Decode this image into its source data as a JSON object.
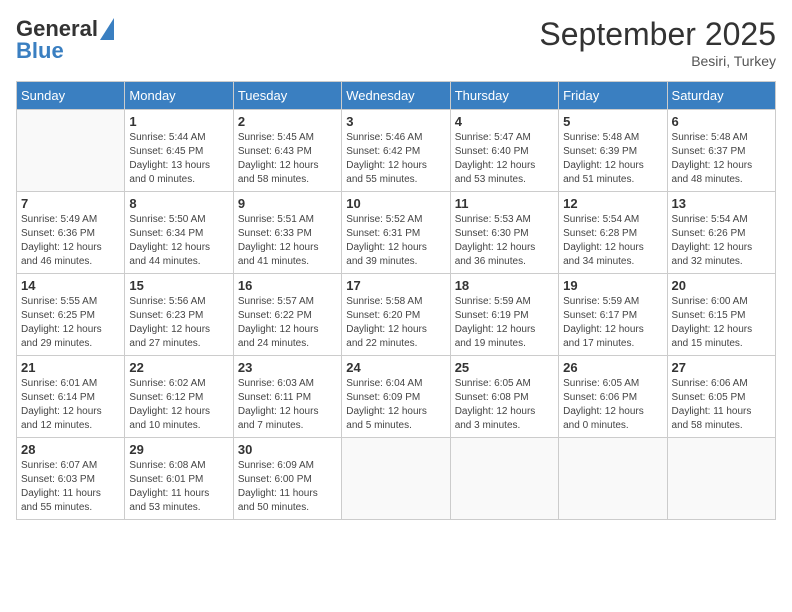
{
  "header": {
    "logo_general": "General",
    "logo_blue": "Blue",
    "month": "September 2025",
    "location": "Besiri, Turkey"
  },
  "days_of_week": [
    "Sunday",
    "Monday",
    "Tuesday",
    "Wednesday",
    "Thursday",
    "Friday",
    "Saturday"
  ],
  "weeks": [
    [
      {
        "day": "",
        "info": ""
      },
      {
        "day": "1",
        "info": "Sunrise: 5:44 AM\nSunset: 6:45 PM\nDaylight: 13 hours\nand 0 minutes."
      },
      {
        "day": "2",
        "info": "Sunrise: 5:45 AM\nSunset: 6:43 PM\nDaylight: 12 hours\nand 58 minutes."
      },
      {
        "day": "3",
        "info": "Sunrise: 5:46 AM\nSunset: 6:42 PM\nDaylight: 12 hours\nand 55 minutes."
      },
      {
        "day": "4",
        "info": "Sunrise: 5:47 AM\nSunset: 6:40 PM\nDaylight: 12 hours\nand 53 minutes."
      },
      {
        "day": "5",
        "info": "Sunrise: 5:48 AM\nSunset: 6:39 PM\nDaylight: 12 hours\nand 51 minutes."
      },
      {
        "day": "6",
        "info": "Sunrise: 5:48 AM\nSunset: 6:37 PM\nDaylight: 12 hours\nand 48 minutes."
      }
    ],
    [
      {
        "day": "7",
        "info": "Sunrise: 5:49 AM\nSunset: 6:36 PM\nDaylight: 12 hours\nand 46 minutes."
      },
      {
        "day": "8",
        "info": "Sunrise: 5:50 AM\nSunset: 6:34 PM\nDaylight: 12 hours\nand 44 minutes."
      },
      {
        "day": "9",
        "info": "Sunrise: 5:51 AM\nSunset: 6:33 PM\nDaylight: 12 hours\nand 41 minutes."
      },
      {
        "day": "10",
        "info": "Sunrise: 5:52 AM\nSunset: 6:31 PM\nDaylight: 12 hours\nand 39 minutes."
      },
      {
        "day": "11",
        "info": "Sunrise: 5:53 AM\nSunset: 6:30 PM\nDaylight: 12 hours\nand 36 minutes."
      },
      {
        "day": "12",
        "info": "Sunrise: 5:54 AM\nSunset: 6:28 PM\nDaylight: 12 hours\nand 34 minutes."
      },
      {
        "day": "13",
        "info": "Sunrise: 5:54 AM\nSunset: 6:26 PM\nDaylight: 12 hours\nand 32 minutes."
      }
    ],
    [
      {
        "day": "14",
        "info": "Sunrise: 5:55 AM\nSunset: 6:25 PM\nDaylight: 12 hours\nand 29 minutes."
      },
      {
        "day": "15",
        "info": "Sunrise: 5:56 AM\nSunset: 6:23 PM\nDaylight: 12 hours\nand 27 minutes."
      },
      {
        "day": "16",
        "info": "Sunrise: 5:57 AM\nSunset: 6:22 PM\nDaylight: 12 hours\nand 24 minutes."
      },
      {
        "day": "17",
        "info": "Sunrise: 5:58 AM\nSunset: 6:20 PM\nDaylight: 12 hours\nand 22 minutes."
      },
      {
        "day": "18",
        "info": "Sunrise: 5:59 AM\nSunset: 6:19 PM\nDaylight: 12 hours\nand 19 minutes."
      },
      {
        "day": "19",
        "info": "Sunrise: 5:59 AM\nSunset: 6:17 PM\nDaylight: 12 hours\nand 17 minutes."
      },
      {
        "day": "20",
        "info": "Sunrise: 6:00 AM\nSunset: 6:15 PM\nDaylight: 12 hours\nand 15 minutes."
      }
    ],
    [
      {
        "day": "21",
        "info": "Sunrise: 6:01 AM\nSunset: 6:14 PM\nDaylight: 12 hours\nand 12 minutes."
      },
      {
        "day": "22",
        "info": "Sunrise: 6:02 AM\nSunset: 6:12 PM\nDaylight: 12 hours\nand 10 minutes."
      },
      {
        "day": "23",
        "info": "Sunrise: 6:03 AM\nSunset: 6:11 PM\nDaylight: 12 hours\nand 7 minutes."
      },
      {
        "day": "24",
        "info": "Sunrise: 6:04 AM\nSunset: 6:09 PM\nDaylight: 12 hours\nand 5 minutes."
      },
      {
        "day": "25",
        "info": "Sunrise: 6:05 AM\nSunset: 6:08 PM\nDaylight: 12 hours\nand 3 minutes."
      },
      {
        "day": "26",
        "info": "Sunrise: 6:05 AM\nSunset: 6:06 PM\nDaylight: 12 hours\nand 0 minutes."
      },
      {
        "day": "27",
        "info": "Sunrise: 6:06 AM\nSunset: 6:05 PM\nDaylight: 11 hours\nand 58 minutes."
      }
    ],
    [
      {
        "day": "28",
        "info": "Sunrise: 6:07 AM\nSunset: 6:03 PM\nDaylight: 11 hours\nand 55 minutes."
      },
      {
        "day": "29",
        "info": "Sunrise: 6:08 AM\nSunset: 6:01 PM\nDaylight: 11 hours\nand 53 minutes."
      },
      {
        "day": "30",
        "info": "Sunrise: 6:09 AM\nSunset: 6:00 PM\nDaylight: 11 hours\nand 50 minutes."
      },
      {
        "day": "",
        "info": ""
      },
      {
        "day": "",
        "info": ""
      },
      {
        "day": "",
        "info": ""
      },
      {
        "day": "",
        "info": ""
      }
    ]
  ]
}
